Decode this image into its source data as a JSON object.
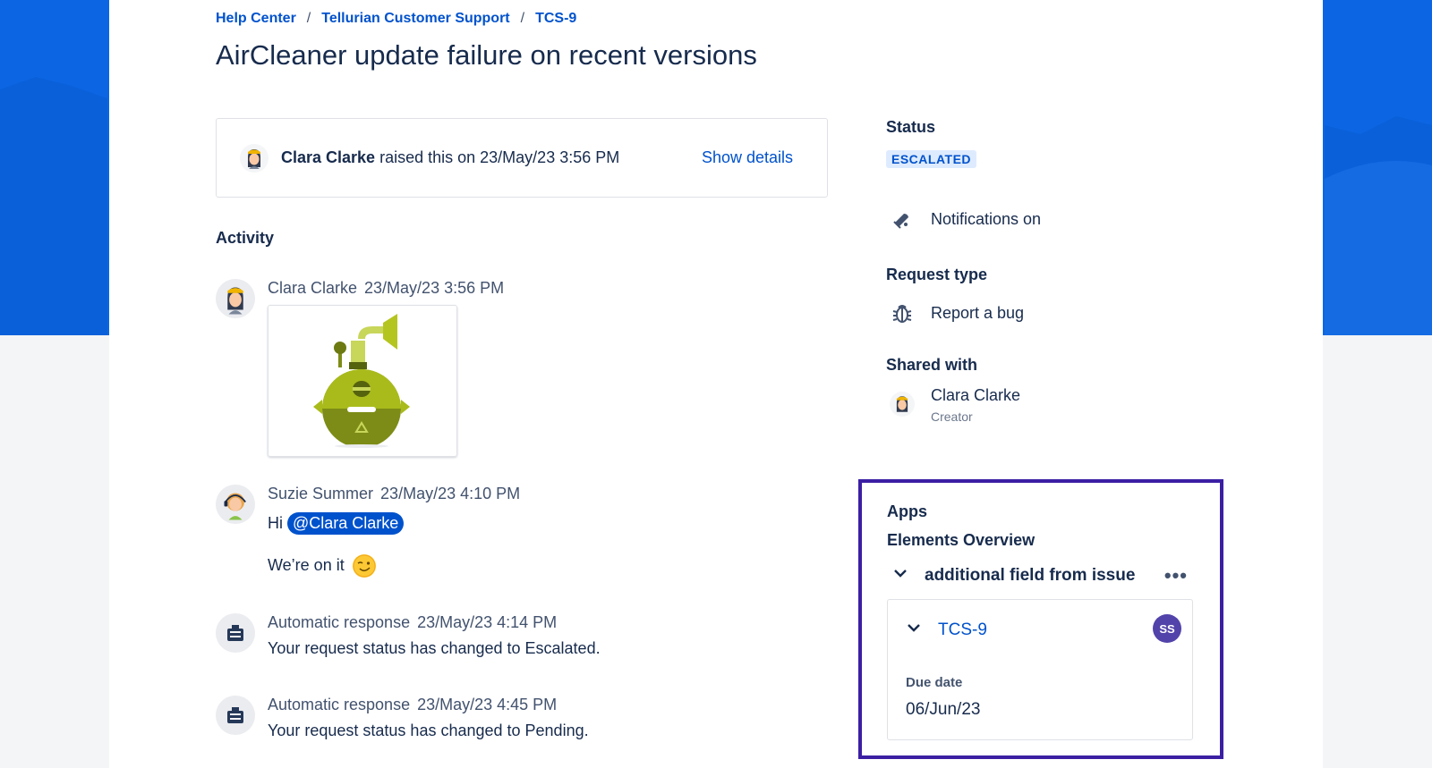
{
  "breadcrumb": {
    "help_center": "Help Center",
    "project": "Tellurian Customer Support",
    "issue": "TCS-9"
  },
  "title": "AirCleaner update failure on recent versions",
  "raised": {
    "name": "Clara Clarke",
    "text": "raised this on 23/May/23 3:56 PM",
    "show_details": "Show details"
  },
  "activity": {
    "heading": "Activity",
    "entries": [
      {
        "name": "Clara Clarke",
        "time": "23/May/23 3:56 PM"
      },
      {
        "name": "Suzie Summer",
        "time": "23/May/23 4:10 PM",
        "hi": "Hi",
        "mention": "@Clara Clarke",
        "message": "We’re on it"
      },
      {
        "name": "Automatic response",
        "time": "23/May/23 4:14 PM",
        "message": "Your request status has changed to Escalated."
      },
      {
        "name": "Automatic response",
        "time": "23/May/23 4:45 PM",
        "message": "Your request status has changed to Pending."
      }
    ]
  },
  "sidebar": {
    "status_label": "Status",
    "status_value": "ESCALATED",
    "notifications": "Notifications on",
    "request_type_label": "Request type",
    "request_type_value": "Report a bug",
    "shared_with_label": "Shared with",
    "shared_name": "Clara Clarke",
    "shared_role": "Creator"
  },
  "apps": {
    "title": "Apps",
    "subtitle": "Elements Overview",
    "section": "additional field from issue",
    "more": "•••",
    "issue_key": "TCS-9",
    "assignee_initials": "SS",
    "due_label": "Due date",
    "due_value": "06/Jun/23"
  },
  "colors": {
    "brand_blue": "#0c66e4",
    "link": "#0052cc",
    "highlight_border": "#3b1fa3",
    "avatar_purple": "#5243aa"
  }
}
